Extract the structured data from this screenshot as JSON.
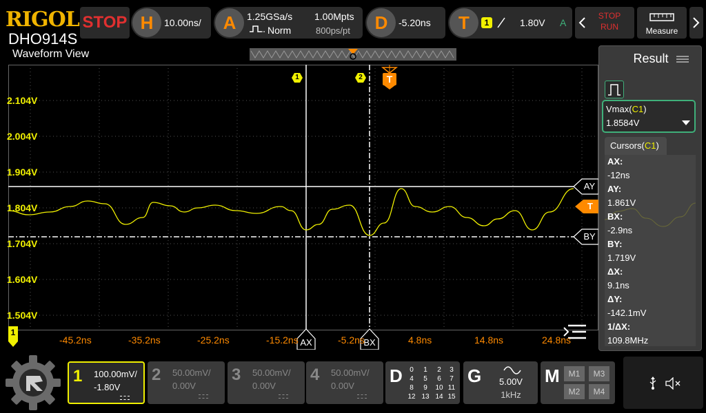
{
  "brand": "RIGOL",
  "model": "DHO914S",
  "view_title": "Waveform View",
  "run_state": "STOP",
  "horizontal": {
    "letter": "H",
    "timebase": "10.00ns/"
  },
  "acquire": {
    "letter": "A",
    "sample_rate": "1.25GSa/s",
    "memory_depth": "1.00Mpts",
    "mode": "Norm",
    "resolution": "800ps/pt"
  },
  "delay": {
    "letter": "D",
    "value": "-5.20ns"
  },
  "trigger": {
    "letter": "T",
    "source": "1",
    "level": "1.80V",
    "mode_letter": "A"
  },
  "right_buttons": {
    "stop_label": "STOP",
    "run_label": "RUN",
    "measure_label": "Measure"
  },
  "y_axis_labels": [
    "2.104V",
    "2.004V",
    "1.904V",
    "1.804V",
    "1.704V",
    "1.604V",
    "1.504V"
  ],
  "x_axis_labels": [
    "-45.2ns",
    "-35.2ns",
    "-25.2ns",
    "-15.2ns",
    "-5.2ns",
    "4.8ns",
    "14.8ns",
    "24.8ns"
  ],
  "markers": {
    "cursor_a_tag": "1",
    "cursor_b_tag": "2",
    "trigger_tag": "T",
    "channel_tag": "1",
    "ax": "AX",
    "bx": "BX",
    "ay": "AY",
    "by": "BY",
    "trig_level": "T"
  },
  "result": {
    "title": "Result",
    "measurement": {
      "name": "Vmax(",
      "channel": "C1",
      "name_end": ")",
      "value": "1.8584V"
    },
    "cursors_tab": {
      "name": "Cursors(",
      "channel": "C1",
      "name_end": ")"
    },
    "cursors": [
      {
        "key": "AX:",
        "value": "-12ns"
      },
      {
        "key": "AY:",
        "value": "1.861V"
      },
      {
        "key": "BX:",
        "value": "-2.9ns"
      },
      {
        "key": "BY:",
        "value": "1.719V"
      },
      {
        "key": "ΔX:",
        "value": "9.1ns"
      },
      {
        "key": "ΔY:",
        "value": "-142.1mV"
      },
      {
        "key": "1/ΔX:",
        "value": "109.8MHz"
      }
    ]
  },
  "channels": [
    {
      "num": "1",
      "scale": "100.00mV/",
      "offset": "-1.80V",
      "active": true
    },
    {
      "num": "2",
      "scale": "50.00mV/",
      "offset": "0.00V",
      "active": false
    },
    {
      "num": "3",
      "scale": "50.00mV/",
      "offset": "0.00V",
      "active": false
    },
    {
      "num": "4",
      "scale": "50.00mV/",
      "offset": "0.00V",
      "active": false
    }
  ],
  "digital": {
    "letter": "D",
    "channels": [
      "0",
      "1",
      "2",
      "3",
      "4",
      "5",
      "6",
      "7",
      "8",
      "9",
      "10",
      "11",
      "12",
      "13",
      "14",
      "15"
    ]
  },
  "generator": {
    "letter": "G",
    "amplitude": "5.00V",
    "frequency": "1kHz"
  },
  "math": {
    "letter": "M",
    "items": [
      "M1",
      "M3",
      "M2",
      "M4"
    ]
  },
  "colors": {
    "ch1": "#f0f000",
    "accent": "#ff8a00",
    "stop": "#e03030",
    "highlight": "#3fb07a"
  }
}
